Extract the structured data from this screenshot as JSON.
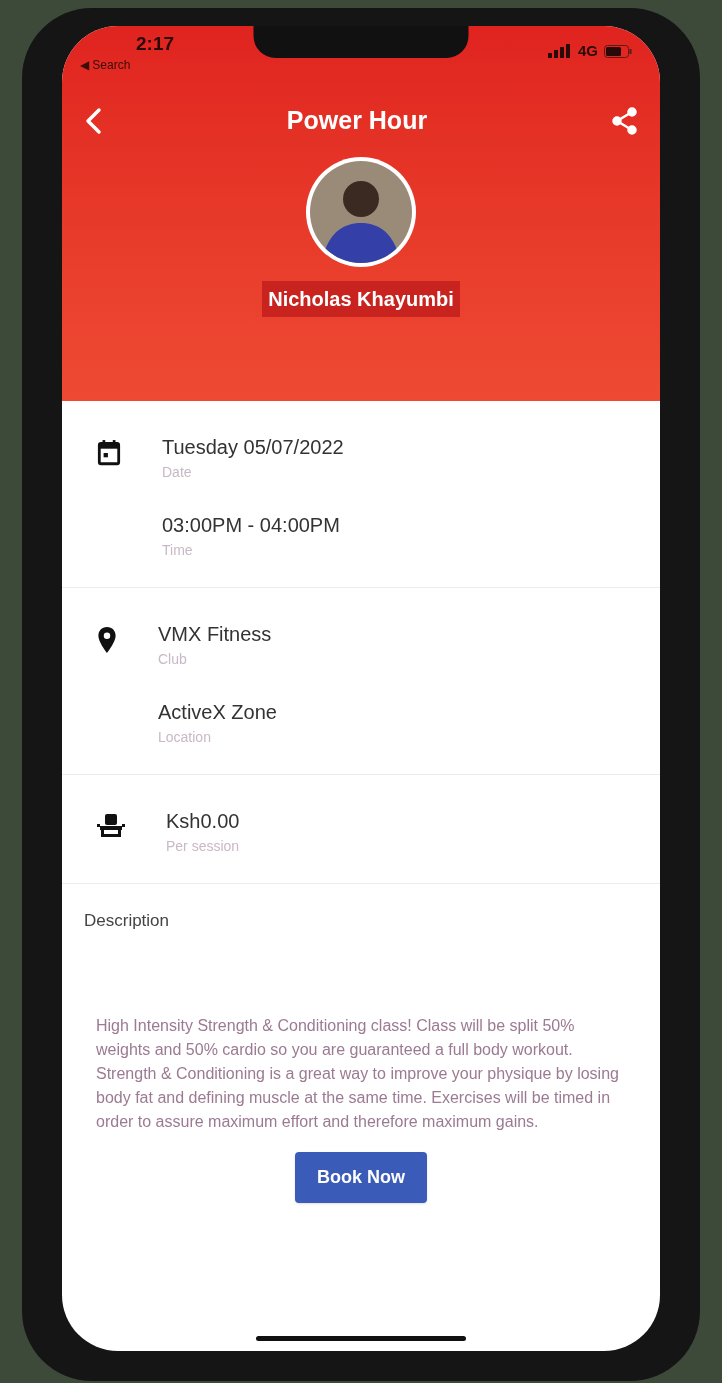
{
  "status_bar": {
    "time": "2:17",
    "back_app": "◀ Search",
    "network": "4G"
  },
  "header": {
    "title": "Power Hour",
    "instructor": "Nicholas Khayumbi"
  },
  "details": [
    {
      "kind": "calendar",
      "items": [
        {
          "value": "Tuesday 05/07/2022",
          "label": "Date"
        },
        {
          "value": "03:00PM - 04:00PM",
          "label": "Time"
        }
      ]
    },
    {
      "kind": "pin",
      "items": [
        {
          "value": "VMX Fitness",
          "label": "Club"
        },
        {
          "value": "ActiveX Zone",
          "label": "Location"
        }
      ]
    },
    {
      "kind": "seat",
      "items": [
        {
          "value": "Ksh0.00",
          "label": "Per session"
        }
      ]
    }
  ],
  "description": {
    "heading": "Description",
    "text": "High Intensity Strength & Conditioning class! Class will be split 50% weights and 50% cardio so you are guaranteed a full body workout. Strength & Conditioning is a great way to improve your physique by losing body fat and defining muscle at the same time. Exercises will be timed in order to assure maximum effort and therefore maximum gains."
  },
  "book_button": "Book Now"
}
